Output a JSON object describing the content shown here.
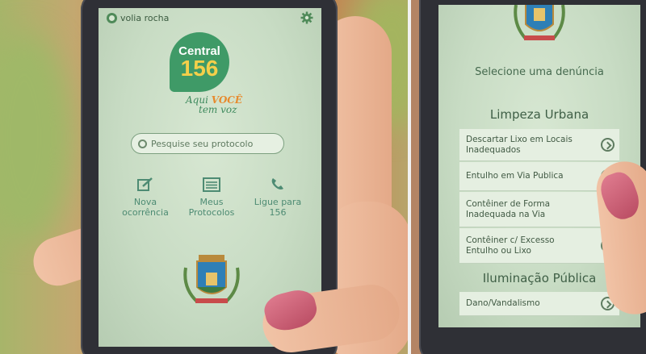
{
  "left_screen": {
    "user_name": "volia rocha",
    "logo_line1": "Central",
    "logo_line2": "156",
    "tagline_part1": "Aqui",
    "tagline_voce": "VOCÊ",
    "tagline_line2": "tem voz",
    "search_placeholder": "Pesquise seu protocolo",
    "actions": [
      {
        "label_line1": "Nova",
        "label_line2": "ocorrência",
        "icon": "edit-icon"
      },
      {
        "label_line1": "Meus",
        "label_line2": "Protocolos",
        "icon": "list-icon"
      },
      {
        "label_line1": "Ligue para",
        "label_line2": "156",
        "icon": "phone-icon"
      }
    ]
  },
  "right_screen": {
    "title": "Selecione uma denúncia",
    "section_1": "Limpeza Urbana",
    "items": [
      {
        "line1": "Descartar Lixo em Locais",
        "line2": "Inadequados"
      },
      {
        "line1": "Entulho em Via Publica",
        "line2": ""
      },
      {
        "line1": "Contêiner de Forma",
        "line2": "Inadequada na Via"
      },
      {
        "line1": "Contêiner c/ Excesso",
        "line2": "Entulho ou Lixo"
      }
    ],
    "section_2": "Iluminação Pública",
    "items_2": [
      {
        "line1": "Dano/Vandalismo",
        "line2": ""
      }
    ]
  },
  "colors": {
    "brand_green": "#3f9a67",
    "brand_yellow": "#f4cf4a",
    "accent_orange": "#e78a2d",
    "screen_bg": "#d7e7d2"
  }
}
